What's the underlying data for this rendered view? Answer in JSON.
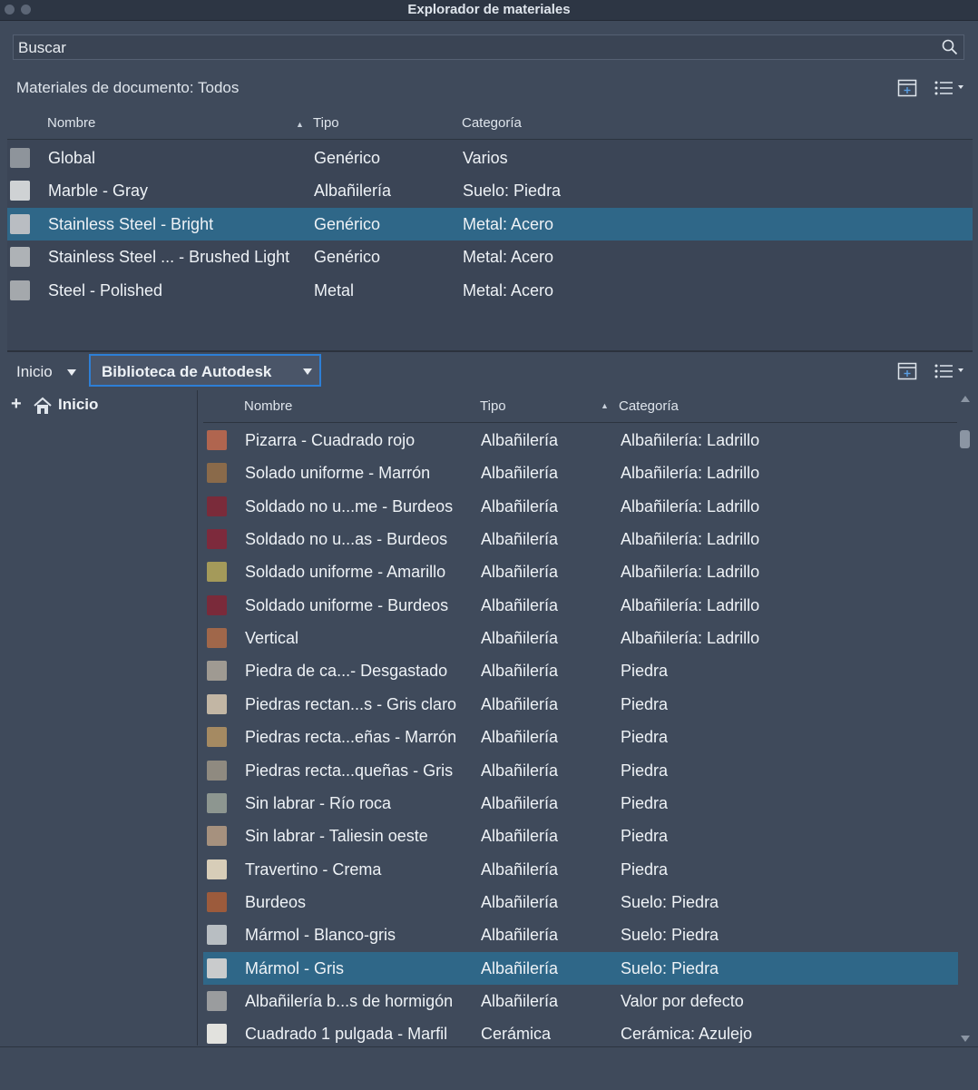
{
  "window": {
    "title": "Explorador de materiales"
  },
  "search": {
    "placeholder": "Buscar"
  },
  "doc_materials": {
    "label": "Materiales de documento: Todos",
    "columns": {
      "name": "Nombre",
      "type": "Tipo",
      "category": "Categoría"
    },
    "rows": [
      {
        "name": "Global",
        "type": "Genérico",
        "category": "Varios",
        "thumb": "#8e949b",
        "selected": false
      },
      {
        "name": "Marble - Gray",
        "type": "Albañilería",
        "category": "Suelo: Piedra",
        "thumb": "#cfd2d4",
        "selected": false
      },
      {
        "name": "Stainless Steel - Bright",
        "type": "Genérico",
        "category": "Metal: Acero",
        "thumb": "#b9bdc2",
        "selected": true
      },
      {
        "name": "Stainless Steel ... - Brushed Light",
        "type": "Genérico",
        "category": "Metal: Acero",
        "thumb": "#aeb2b6",
        "selected": false
      },
      {
        "name": "Steel - Polished",
        "type": "Metal",
        "category": "Metal: Acero",
        "thumb": "#a4a8ac",
        "selected": false
      }
    ]
  },
  "library_bar": {
    "home_label": "Inicio",
    "library_label": "Biblioteca de Autodesk"
  },
  "tree": {
    "root_label": "Inicio"
  },
  "library": {
    "columns": {
      "name": "Nombre",
      "type": "Tipo",
      "category": "Categoría"
    },
    "rows": [
      {
        "name": "Pizarra - Cuadrado rojo",
        "type": "Albañilería",
        "category": "Albañilería: Ladrillo",
        "thumb": "#b0654f",
        "selected": false
      },
      {
        "name": "Solado uniforme - Marrón",
        "type": "Albañilería",
        "category": "Albañilería: Ladrillo",
        "thumb": "#8a6a4a",
        "selected": false
      },
      {
        "name": "Soldado no u...me - Burdeos",
        "type": "Albañilería",
        "category": "Albañilería: Ladrillo",
        "thumb": "#7a2b3a",
        "selected": false
      },
      {
        "name": "Soldado no u...as - Burdeos",
        "type": "Albañilería",
        "category": "Albañilería: Ladrillo",
        "thumb": "#7d2a3c",
        "selected": false
      },
      {
        "name": "Soldado uniforme - Amarillo",
        "type": "Albañilería",
        "category": "Albañilería: Ladrillo",
        "thumb": "#a49a5a",
        "selected": false
      },
      {
        "name": "Soldado uniforme - Burdeos",
        "type": "Albañilería",
        "category": "Albañilería: Ladrillo",
        "thumb": "#7a2a3a",
        "selected": false
      },
      {
        "name": "Vertical",
        "type": "Albañilería",
        "category": "Albañilería: Ladrillo",
        "thumb": "#a0674a",
        "selected": false
      },
      {
        "name": "Piedra de ca...- Desgastado",
        "type": "Albañilería",
        "category": "Piedra",
        "thumb": "#9f9a92",
        "selected": false
      },
      {
        "name": "Piedras rectan...s - Gris claro",
        "type": "Albañilería",
        "category": "Piedra",
        "thumb": "#c2b6a4",
        "selected": false
      },
      {
        "name": "Piedras recta...eñas - Marrón",
        "type": "Albañilería",
        "category": "Piedra",
        "thumb": "#a58a62",
        "selected": false
      },
      {
        "name": "Piedras recta...queñas - Gris",
        "type": "Albañilería",
        "category": "Piedra",
        "thumb": "#8f8a80",
        "selected": false
      },
      {
        "name": "Sin labrar - Río roca",
        "type": "Albañilería",
        "category": "Piedra",
        "thumb": "#8d9690",
        "selected": false
      },
      {
        "name": "Sin labrar - Taliesin oeste",
        "type": "Albañilería",
        "category": "Piedra",
        "thumb": "#a6917e",
        "selected": false
      },
      {
        "name": "Travertino - Crema",
        "type": "Albañilería",
        "category": "Piedra",
        "thumb": "#d7cdb8",
        "selected": false
      },
      {
        "name": "Burdeos",
        "type": "Albañilería",
        "category": "Suelo: Piedra",
        "thumb": "#9c5b3c",
        "selected": false
      },
      {
        "name": "Mármol - Blanco-gris",
        "type": "Albañilería",
        "category": "Suelo: Piedra",
        "thumb": "#b8bec2",
        "selected": false
      },
      {
        "name": "Mármol - Gris",
        "type": "Albañilería",
        "category": "Suelo: Piedra",
        "thumb": "#c9cbcc",
        "selected": true
      },
      {
        "name": "Albañilería b...s de hormigón",
        "type": "Albañilería",
        "category": "Valor por defecto",
        "thumb": "#9a9c9e",
        "selected": false
      },
      {
        "name": "Cuadrado 1 pulgada - Marfil",
        "type": "Cerámica",
        "category": "Cerámica: Azulejo",
        "thumb": "#e2e2de",
        "selected": false
      }
    ]
  },
  "colors": {
    "selection": "#2f6788",
    "focus_ring": "#2d7fd6",
    "panel": "#3f4a5b"
  }
}
